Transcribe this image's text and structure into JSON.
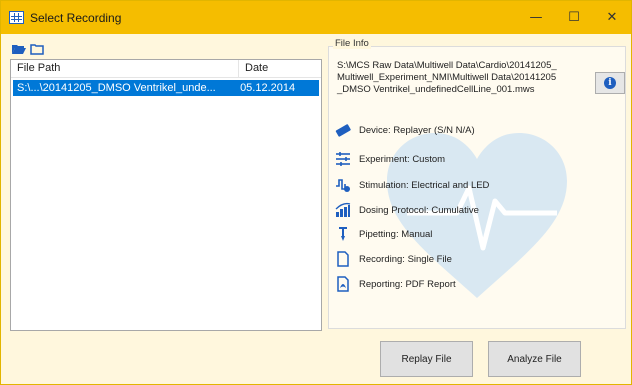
{
  "window": {
    "title": "Select Recording",
    "controls": {
      "minimize": "—",
      "maximize": "☐",
      "close": "✕"
    }
  },
  "toolbar": {
    "icons": [
      "folder-open-icon",
      "folder-icon"
    ]
  },
  "list": {
    "columns": [
      "File Path",
      "Date"
    ],
    "rows": [
      {
        "path": "S:\\...\\20141205_DMSO Ventrikel_unde...",
        "date": "05.12.2014",
        "selected": true
      }
    ]
  },
  "file_info": {
    "title": "File Info",
    "path": "S:\\MCS Raw Data\\Multiwell Data\\Cardio\\20141205_Multiwell_Experiment_NMI\\Multiwell Data\\20141205_DMSO Ventrikel_undefinedCellLine_001.mws",
    "info_icon": "i",
    "properties": [
      {
        "icon": "device-icon",
        "label": "Device: Replayer (S/N N/A)"
      },
      {
        "icon": "experiment-icon",
        "label": "Experiment: Custom"
      },
      {
        "icon": "stimulation-icon",
        "label": "Stimulation: Electrical and LED"
      },
      {
        "icon": "dosing-icon",
        "label": "Dosing Protocol: Cumulative"
      },
      {
        "icon": "pipette-icon",
        "label": "Pipetting: Manual"
      },
      {
        "icon": "file-icon",
        "label": "Recording: Single File"
      },
      {
        "icon": "pdf-report-icon",
        "label": "Reporting: PDF Report"
      }
    ]
  },
  "buttons": {
    "replay": "Replay File",
    "analyze": "Analyze File"
  },
  "colors": {
    "titlebar": "#f5bd00",
    "selection": "#0078d7",
    "heart": "#cfe3f3"
  }
}
